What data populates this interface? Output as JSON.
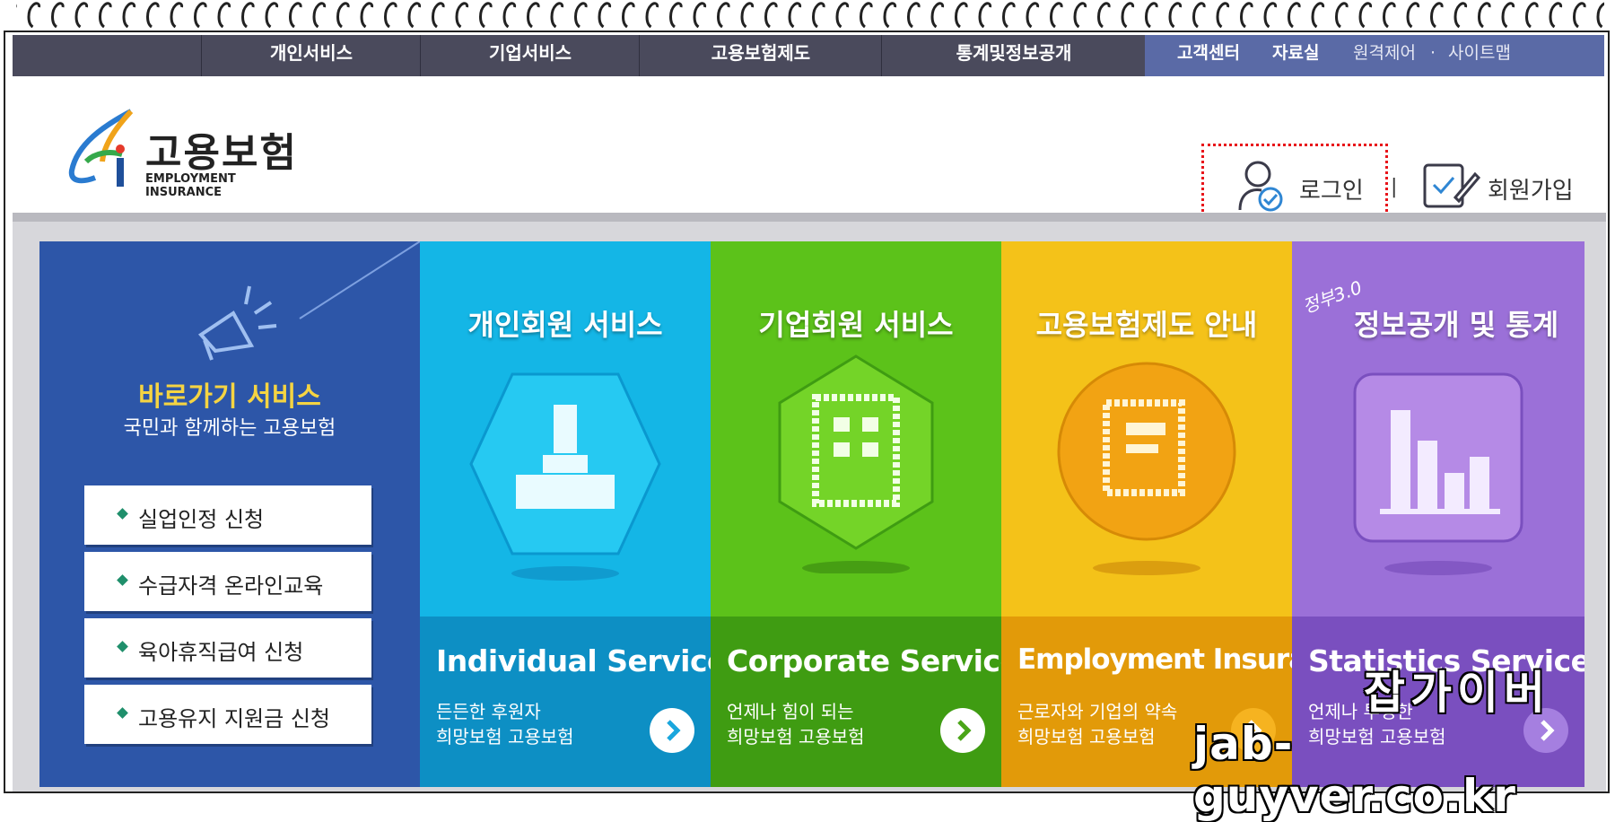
{
  "top_nav": {
    "menus": [
      "개인서비스",
      "기업서비스",
      "고용보험제도",
      "통계및정보공개"
    ],
    "right_links": [
      "고객센터",
      "자료실",
      "원격제어",
      "사이트맵"
    ]
  },
  "header": {
    "logo_title": "고용보험",
    "logo_subtitle": "EMPLOYMENT INSURANCE",
    "login_label": "로그인",
    "signup_label": "회원가입"
  },
  "quick": {
    "title": "바로가기 서비스",
    "subtitle": "국민과 함께하는 고용보험",
    "items": [
      "실업인정 신청",
      "수급자격 온라인교육",
      "육아휴직급여 신청",
      "고용유지 지원금 신청"
    ]
  },
  "panels": [
    {
      "title": "개인회원 서비스",
      "en": "Individual Service",
      "desc1": "든든한 후원자",
      "desc2": "희망보험 고용보험",
      "top_color": "#14b6e6",
      "bottom_color": "#0d8fc4",
      "arrow_color": "#1aa6dd"
    },
    {
      "title": "기업회원 서비스",
      "en": "Corporate Service",
      "desc1": "언제나 힘이 되는",
      "desc2": "희망보험 고용보험",
      "top_color": "#5cc21a",
      "bottom_color": "#3f9c12",
      "arrow_color": "#4aa518"
    },
    {
      "title": "고용보험제도 안내",
      "en": "Employment Insurance",
      "desc1": "근로자와 기업의 약속",
      "desc2": "희망보험 고용보험",
      "top_color": "#f4c219",
      "bottom_color": "#e29a09",
      "arrow_color": "#e8a40c"
    },
    {
      "title": "정보공개 및 통계",
      "badge": "정부3.0",
      "en": "Statistics Service",
      "desc1": "언제나 투명한",
      "desc2": "희망보험 고용보험",
      "top_color": "#9b70d8",
      "bottom_color": "#7a4fbf",
      "arrow_color": "#8d5fd0"
    }
  ],
  "watermark": {
    "line1": "잡가이버",
    "line2": "jab-guyver.co.kr"
  },
  "colors": {
    "nav_bg": "#4a4a5c",
    "nav_right_bg": "#5a6aa6",
    "quick_bg": "#2d56a8",
    "highlight_border": "#e8141a"
  }
}
